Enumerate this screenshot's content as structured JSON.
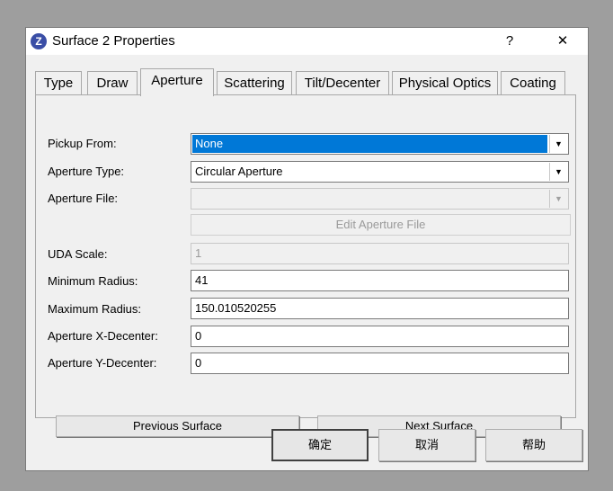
{
  "window": {
    "title": "Surface 2 Properties",
    "icon": "Z",
    "help_glyph": "?",
    "close_glyph": "✕"
  },
  "tabs": [
    "Type",
    "Draw",
    "Aperture",
    "Scattering",
    "Tilt/Decenter",
    "Physical Optics",
    "Coating"
  ],
  "active_tab": "Aperture",
  "form": {
    "pickup_from": {
      "label": "Pickup From:",
      "value": "None"
    },
    "aperture_type": {
      "label": "Aperture Type:",
      "value": "Circular Aperture"
    },
    "aperture_file": {
      "label": "Aperture File:",
      "value": ""
    },
    "edit_aperture_file": "Edit Aperture File",
    "uda_scale": {
      "label": "UDA Scale:",
      "value": "1"
    },
    "minimum_radius": {
      "label": "Minimum Radius:",
      "value": "41"
    },
    "maximum_radius": {
      "label": "Maximum Radius:",
      "value": "150.010520255"
    },
    "x_decenter": {
      "label": "Aperture X-Decenter:",
      "value": "0"
    },
    "y_decenter": {
      "label": "Aperture Y-Decenter:",
      "value": "0"
    }
  },
  "nav": {
    "previous": "Previous Surface",
    "next": "Next Surface"
  },
  "footer": {
    "ok": "确定",
    "cancel": "取消",
    "help": "帮助"
  },
  "colors": {
    "selection": "#0078d7",
    "dialog_bg": "#f0f0f0",
    "backdrop": "#9e9e9e"
  }
}
